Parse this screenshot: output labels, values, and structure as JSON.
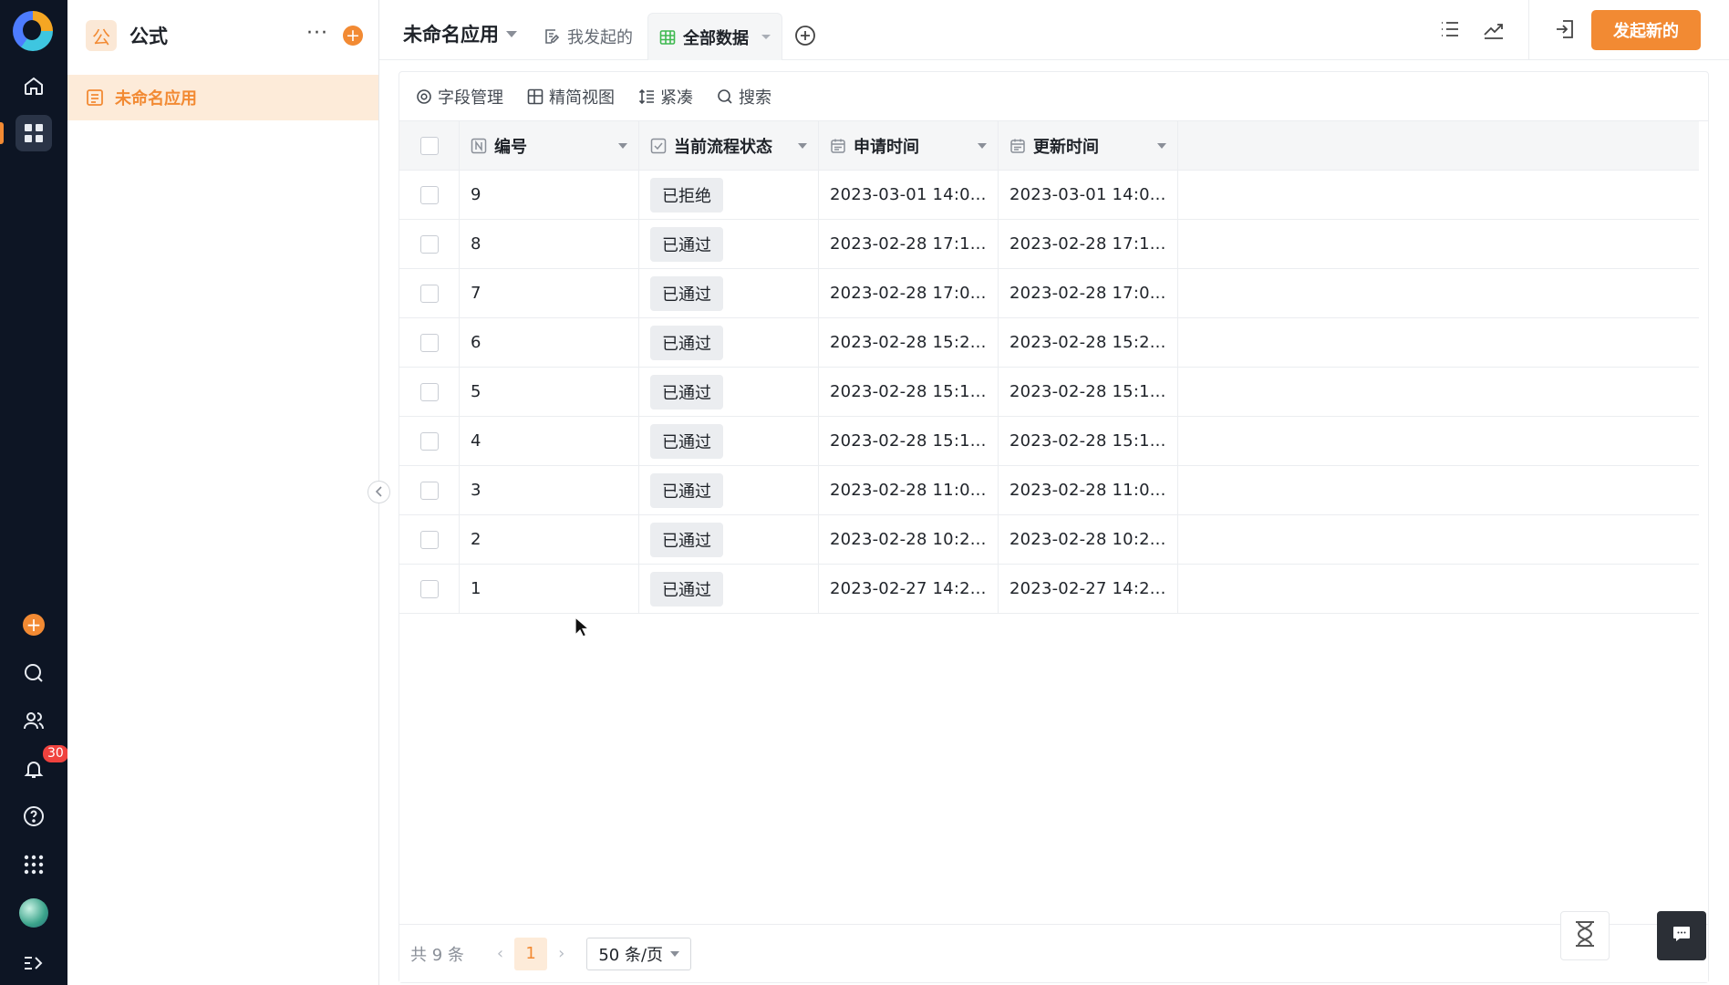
{
  "sidebar_rail": {
    "badge_count": "30",
    "icons": [
      "home-icon",
      "apps-grid-icon",
      "add-icon",
      "search-icon",
      "contacts-icon",
      "bell-icon",
      "help-icon",
      "app-launcher-icon",
      "avatar",
      "expand-icon"
    ]
  },
  "side_panel": {
    "app_icon_char": "公",
    "title": "公式",
    "more": "···",
    "add": "+",
    "items": [
      {
        "label": "未命名应用"
      }
    ]
  },
  "topbar": {
    "app_name": "未命名应用",
    "tabs": [
      {
        "label": "我发起的",
        "active": false
      },
      {
        "label": "全部数据",
        "active": true
      }
    ],
    "primary_button": "发起新的"
  },
  "toolbar": {
    "field_manage": "字段管理",
    "compact_view": "精简视图",
    "density": "紧凑",
    "search": "搜索"
  },
  "table": {
    "columns": [
      "编号",
      "当前流程状态",
      "申请时间",
      "更新时间"
    ],
    "rows": [
      {
        "id": "9",
        "status": "已拒绝",
        "applied": "2023-03-01 14:0...",
        "updated": "2023-03-01 14:0..."
      },
      {
        "id": "8",
        "status": "已通过",
        "applied": "2023-02-28 17:1...",
        "updated": "2023-02-28 17:1..."
      },
      {
        "id": "7",
        "status": "已通过",
        "applied": "2023-02-28 17:0...",
        "updated": "2023-02-28 17:0..."
      },
      {
        "id": "6",
        "status": "已通过",
        "applied": "2023-02-28 15:2...",
        "updated": "2023-02-28 15:2..."
      },
      {
        "id": "5",
        "status": "已通过",
        "applied": "2023-02-28 15:1...",
        "updated": "2023-02-28 15:1..."
      },
      {
        "id": "4",
        "status": "已通过",
        "applied": "2023-02-28 15:1...",
        "updated": "2023-02-28 15:1..."
      },
      {
        "id": "3",
        "status": "已通过",
        "applied": "2023-02-28 11:0...",
        "updated": "2023-02-28 11:0..."
      },
      {
        "id": "2",
        "status": "已通过",
        "applied": "2023-02-28 10:2...",
        "updated": "2023-02-28 10:2..."
      },
      {
        "id": "1",
        "status": "已通过",
        "applied": "2023-02-27 14:2...",
        "updated": "2023-02-27 14:2..."
      }
    ]
  },
  "footer": {
    "total": "共 9 条",
    "current_page": "1",
    "page_size": "50 条/页"
  },
  "colors": {
    "accent": "#f28a33",
    "rail_bg": "#0d1524",
    "badge": "#f0423e"
  }
}
